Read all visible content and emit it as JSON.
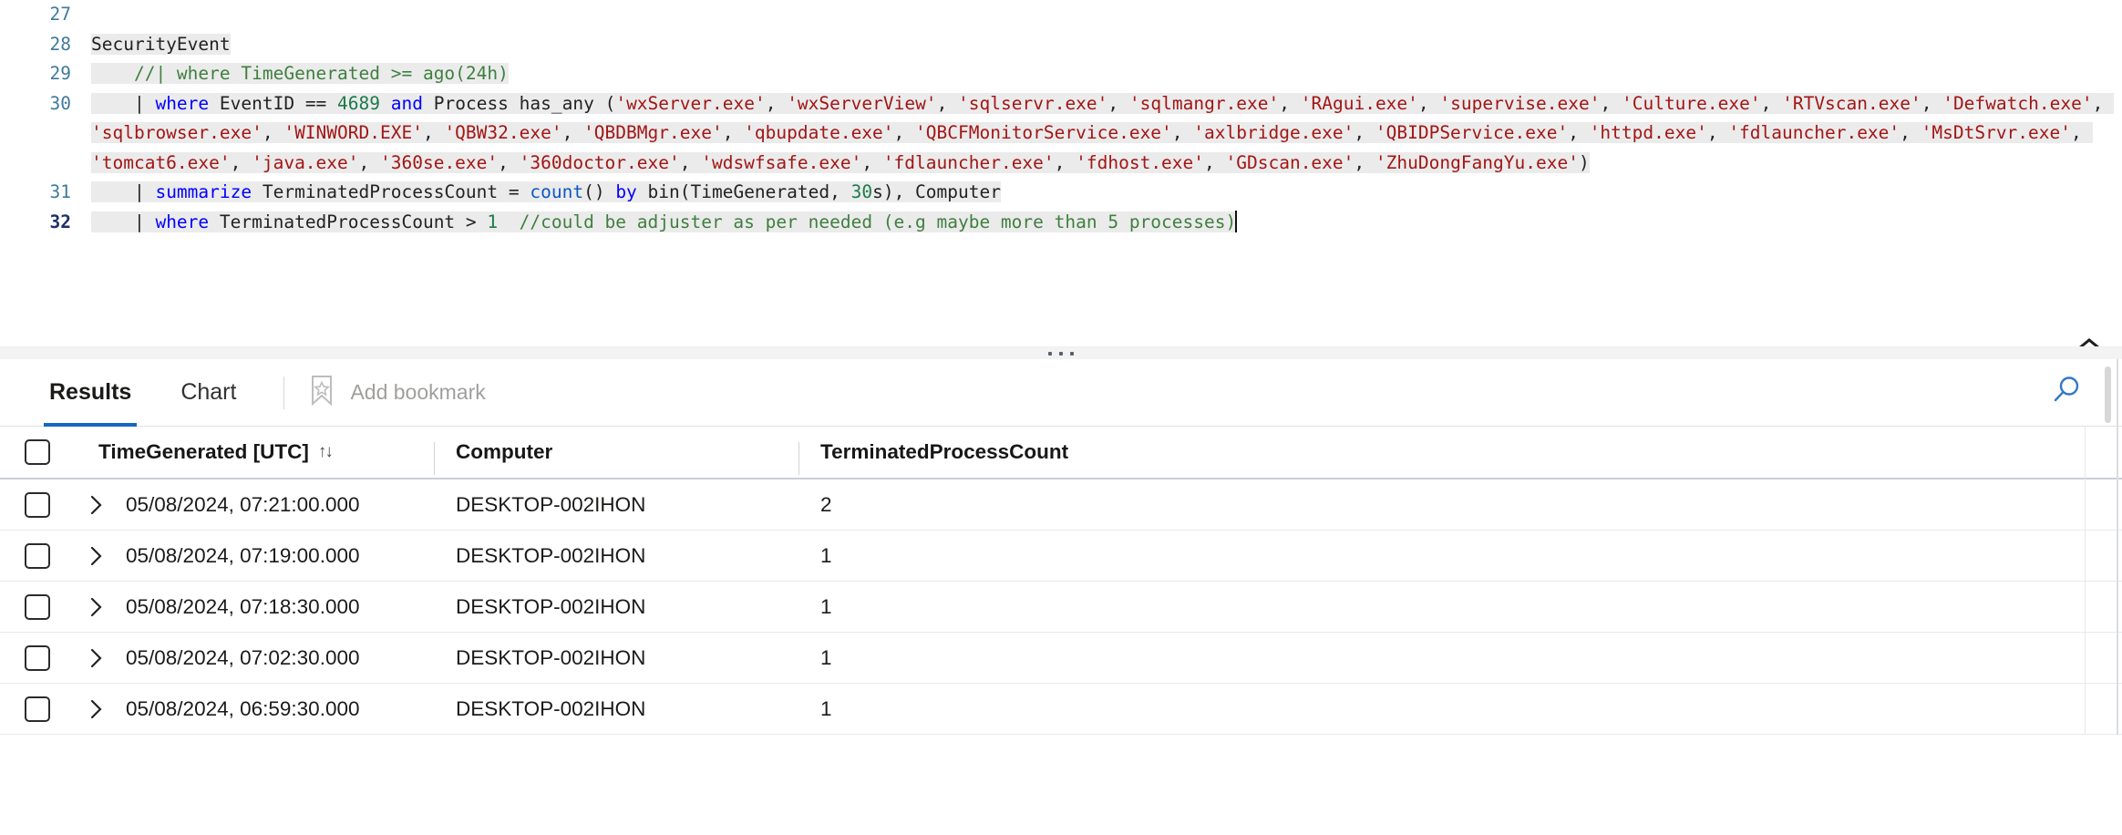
{
  "editor": {
    "lines": [
      {
        "number": "27",
        "active": false,
        "segments": []
      },
      {
        "number": "28",
        "active": false,
        "segments": [
          {
            "text": "SecurityEvent",
            "cls": "op"
          }
        ]
      },
      {
        "number": "29",
        "active": false,
        "segments": [
          {
            "text": "    //| where TimeGenerated >= ago(24h)",
            "cls": "com"
          }
        ]
      },
      {
        "number": "30",
        "active": false,
        "segments": [
          {
            "text": "    | ",
            "cls": "op"
          },
          {
            "text": "where",
            "cls": "kw"
          },
          {
            "text": " EventID == ",
            "cls": "op"
          },
          {
            "text": "4689",
            "cls": "num"
          },
          {
            "text": " ",
            "cls": "op"
          },
          {
            "text": "and",
            "cls": "kw"
          },
          {
            "text": " Process has_any (",
            "cls": "op"
          },
          {
            "text": "'wxServer.exe'",
            "cls": "str"
          },
          {
            "text": ", ",
            "cls": "op"
          },
          {
            "text": "'wxServerView'",
            "cls": "str"
          },
          {
            "text": ", ",
            "cls": "op"
          },
          {
            "text": "'sqlservr.exe'",
            "cls": "str"
          },
          {
            "text": ", ",
            "cls": "op"
          },
          {
            "text": "'sqlmangr.exe'",
            "cls": "str"
          },
          {
            "text": ", ",
            "cls": "op"
          },
          {
            "text": "'RAgui.exe'",
            "cls": "str"
          },
          {
            "text": ", ",
            "cls": "op"
          },
          {
            "text": "'supervise.exe'",
            "cls": "str"
          },
          {
            "text": ", ",
            "cls": "op"
          },
          {
            "text": "'Culture.exe'",
            "cls": "str"
          },
          {
            "text": ", ",
            "cls": "op"
          },
          {
            "text": "'RTVscan.exe'",
            "cls": "str"
          },
          {
            "text": ", ",
            "cls": "op"
          },
          {
            "text": "'Defwatch.exe'",
            "cls": "str"
          },
          {
            "text": ", ",
            "cls": "op"
          },
          {
            "text": "'sqlbrowser.exe'",
            "cls": "str"
          },
          {
            "text": ", ",
            "cls": "op"
          },
          {
            "text": "'WINWORD.EXE'",
            "cls": "str"
          },
          {
            "text": ", ",
            "cls": "op"
          },
          {
            "text": "'QBW32.exe'",
            "cls": "str"
          },
          {
            "text": ", ",
            "cls": "op"
          },
          {
            "text": "'QBDBMgr.exe'",
            "cls": "str"
          },
          {
            "text": ", ",
            "cls": "op"
          },
          {
            "text": "'qbupdate.exe'",
            "cls": "str"
          },
          {
            "text": ", ",
            "cls": "op"
          },
          {
            "text": "'QBCFMonitorService.exe'",
            "cls": "str"
          },
          {
            "text": ", ",
            "cls": "op"
          },
          {
            "text": "'axlbridge.exe'",
            "cls": "str"
          },
          {
            "text": ", ",
            "cls": "op"
          },
          {
            "text": "'QBIDPService.exe'",
            "cls": "str"
          },
          {
            "text": ", ",
            "cls": "op"
          },
          {
            "text": "'httpd.exe'",
            "cls": "str"
          },
          {
            "text": ", ",
            "cls": "op"
          },
          {
            "text": "'fdlauncher.exe'",
            "cls": "str"
          },
          {
            "text": ", ",
            "cls": "op"
          },
          {
            "text": "'MsDtSrvr.exe'",
            "cls": "str"
          },
          {
            "text": ", ",
            "cls": "op"
          },
          {
            "text": "'tomcat6.exe'",
            "cls": "str"
          },
          {
            "text": ", ",
            "cls": "op"
          },
          {
            "text": "'java.exe'",
            "cls": "str"
          },
          {
            "text": ", ",
            "cls": "op"
          },
          {
            "text": "'360se.exe'",
            "cls": "str"
          },
          {
            "text": ", ",
            "cls": "op"
          },
          {
            "text": "'360doctor.exe'",
            "cls": "str"
          },
          {
            "text": ", ",
            "cls": "op"
          },
          {
            "text": "'wdswfsafe.exe'",
            "cls": "str"
          },
          {
            "text": ", ",
            "cls": "op"
          },
          {
            "text": "'fdlauncher.exe'",
            "cls": "str"
          },
          {
            "text": ", ",
            "cls": "op"
          },
          {
            "text": "'fdhost.exe'",
            "cls": "str"
          },
          {
            "text": ", ",
            "cls": "op"
          },
          {
            "text": "'GDscan.exe'",
            "cls": "str"
          },
          {
            "text": ", ",
            "cls": "op"
          },
          {
            "text": "'ZhuDongFangYu.exe'",
            "cls": "str"
          },
          {
            "text": ")",
            "cls": "op"
          }
        ]
      },
      {
        "number": "31",
        "active": false,
        "segments": [
          {
            "text": "    | ",
            "cls": "op"
          },
          {
            "text": "summarize",
            "cls": "kw"
          },
          {
            "text": " TerminatedProcessCount = ",
            "cls": "op"
          },
          {
            "text": "count",
            "cls": "fn"
          },
          {
            "text": "() ",
            "cls": "op"
          },
          {
            "text": "by",
            "cls": "kw"
          },
          {
            "text": " bin(TimeGenerated, ",
            "cls": "op"
          },
          {
            "text": "30",
            "cls": "num"
          },
          {
            "text": "s), Computer",
            "cls": "op"
          }
        ]
      },
      {
        "number": "32",
        "active": true,
        "segments": [
          {
            "text": "    | ",
            "cls": "op"
          },
          {
            "text": "where",
            "cls": "kw"
          },
          {
            "text": " TerminatedProcessCount > ",
            "cls": "op"
          },
          {
            "text": "1",
            "cls": "num"
          },
          {
            "text": "  //could be adjuster as per needed (e.g maybe more than 5 processes)",
            "cls": "com"
          }
        ]
      }
    ],
    "collapse_icon": "chevron-double-up-icon"
  },
  "splitter": {
    "handle_icon": "splitter-dots"
  },
  "results": {
    "tabs": [
      {
        "label": "Results",
        "active": true
      },
      {
        "label": "Chart",
        "active": false
      }
    ],
    "bookmark": {
      "icon": "bookmark-star-icon",
      "label": "Add bookmark"
    },
    "search_icon": "search-icon",
    "columns": [
      {
        "label": "TimeGenerated [UTC]",
        "sort": "↑↓"
      },
      {
        "label": "Computer",
        "sort": ""
      },
      {
        "label": "TerminatedProcessCount",
        "sort": ""
      }
    ],
    "rows": [
      {
        "time": "05/08/2024, 07:21:00.000",
        "computer": "DESKTOP-002IHON",
        "count": "2"
      },
      {
        "time": "05/08/2024, 07:19:00.000",
        "computer": "DESKTOP-002IHON",
        "count": "1"
      },
      {
        "time": "05/08/2024, 07:18:30.000",
        "computer": "DESKTOP-002IHON",
        "count": "1"
      },
      {
        "time": "05/08/2024, 07:02:30.000",
        "computer": "DESKTOP-002IHON",
        "count": "1"
      },
      {
        "time": "05/08/2024, 06:59:30.000",
        "computer": "DESKTOP-002IHON",
        "count": "1"
      }
    ]
  },
  "colors": {
    "accent": "#1668c1",
    "keyword": "#0000ff",
    "string": "#a31515",
    "comment": "#3f7f3f",
    "number": "#1b7a4a",
    "gutter": "#3e7a9c",
    "selection": "#ebebeb"
  }
}
